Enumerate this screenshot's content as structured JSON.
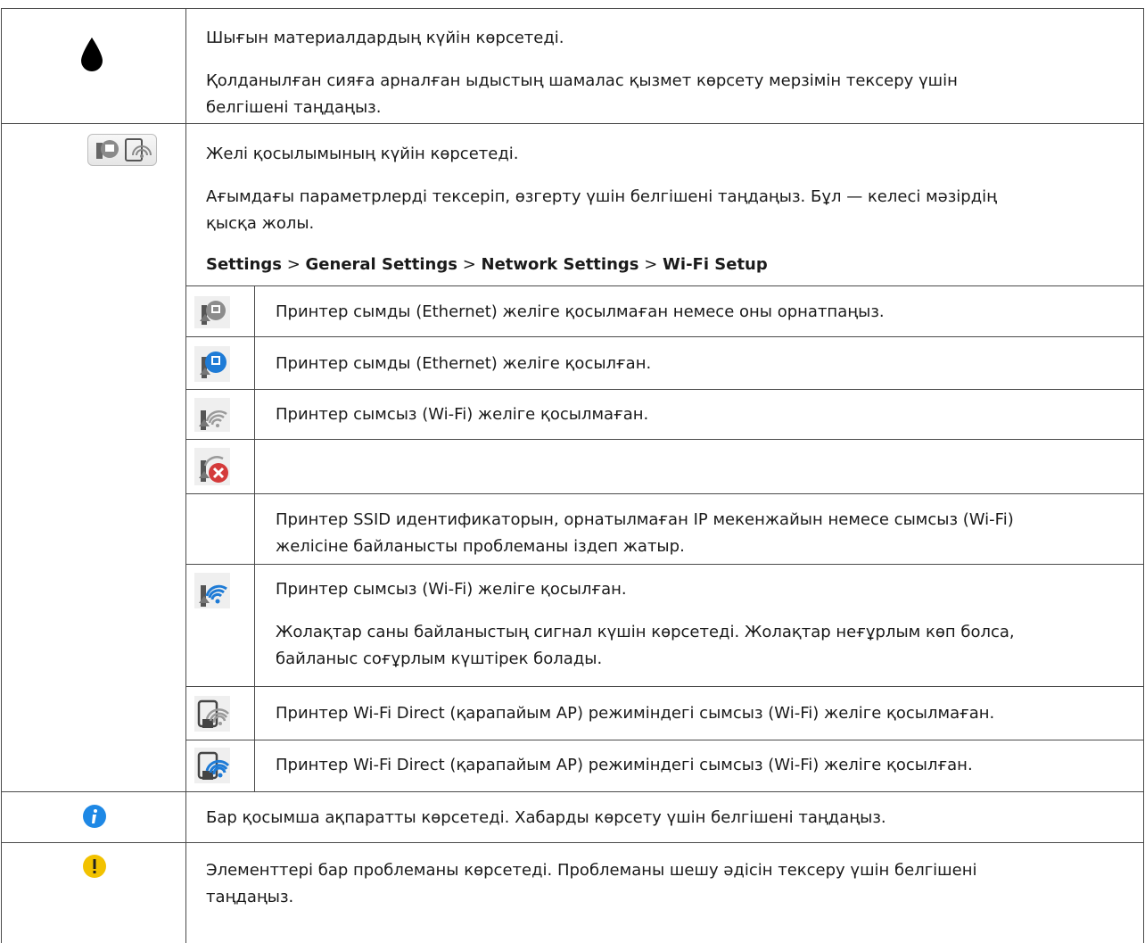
{
  "rows": {
    "ink": {
      "icon": "ink-drop-icon",
      "lines": [
        "Шығын материалдардың күйін көрсетеді.",
        "Қолданылған сияға арналған ыдыстың шамалас қызмет көрсету мерзімін тексеру үшін",
        "белгішені таңдаңыз."
      ]
    },
    "network": {
      "icon": "network-status-icon",
      "lines": [
        "Желі қосылымының күйін көрсетеді.",
        "Ағымдағы параметрлерді тексеріп, өзгерту үшін белгішені таңдаңыз. Бұл — келесі мәзірдің",
        "қысқа жолы."
      ],
      "path": {
        "p1": "Settings",
        "p2": "General Settings",
        "p3": "Network Settings",
        "p4": "Wi-Fi Setup",
        "sep": ">"
      },
      "sub": [
        {
          "icon": "ethernet-disconnected-icon",
          "lines": [
            "Принтер сымды (Ethernet) желіге қосылмаған немесе оны орнатпаңыз."
          ]
        },
        {
          "icon": "ethernet-connected-icon",
          "lines": [
            "Принтер сымды (Ethernet) желіге қосылған."
          ]
        },
        {
          "icon": "wifi-disconnected-icon",
          "lines": [
            "Принтер сымсыз (Wi-Fi) желіге қосылмаған."
          ]
        },
        {
          "icon": "wifi-error-icon",
          "lines": [
            "Принтер SSID идентификаторын, орнатылмаған IP мекенжайын немесе сымсыз (Wi-Fi)",
            "желісіне байланысты проблеманы іздеп жатыр."
          ]
        },
        {
          "icon": "wifi-connected-icon",
          "lines": [
            "Принтер сымсыз (Wi-Fi) желіге қосылған.",
            "Жолақтар саны байланыстың сигнал күшін көрсетеді. Жолақтар неғұрлым көп болса,",
            "байланыс соғұрлым күштірек болады."
          ]
        },
        {
          "icon": "wifi-direct-disconnected-icon",
          "lines": [
            "Принтер Wi-Fi Direct (қарапайым AP) режиміндегі сымсыз (Wi-Fi) желіге қосылмаған."
          ]
        },
        {
          "icon": "wifi-direct-connected-icon",
          "lines": [
            "Принтер Wi-Fi Direct (қарапайым AP) режиміндегі сымсыз (Wi-Fi) желіге қосылған."
          ]
        }
      ]
    },
    "info": {
      "icon": "info-icon",
      "lines": [
        "Бар қосымша ақпаратты көрсетеді. Хабарды көрсету үшін белгішені таңдаңыз."
      ]
    },
    "warning": {
      "icon": "warning-icon",
      "lines": [
        "Элементтері бар проблеманы көрсетеді. Проблеманы шешу әдісін тексеру үшін белгішені",
        "таңдаңыз."
      ]
    }
  },
  "colors": {
    "blue": "#1e7bd6",
    "gray_icon": "#7a7a7a",
    "error_red": "#d43a3a",
    "warning_yellow": "#f2c200",
    "info_blue": "#1e88e5"
  }
}
